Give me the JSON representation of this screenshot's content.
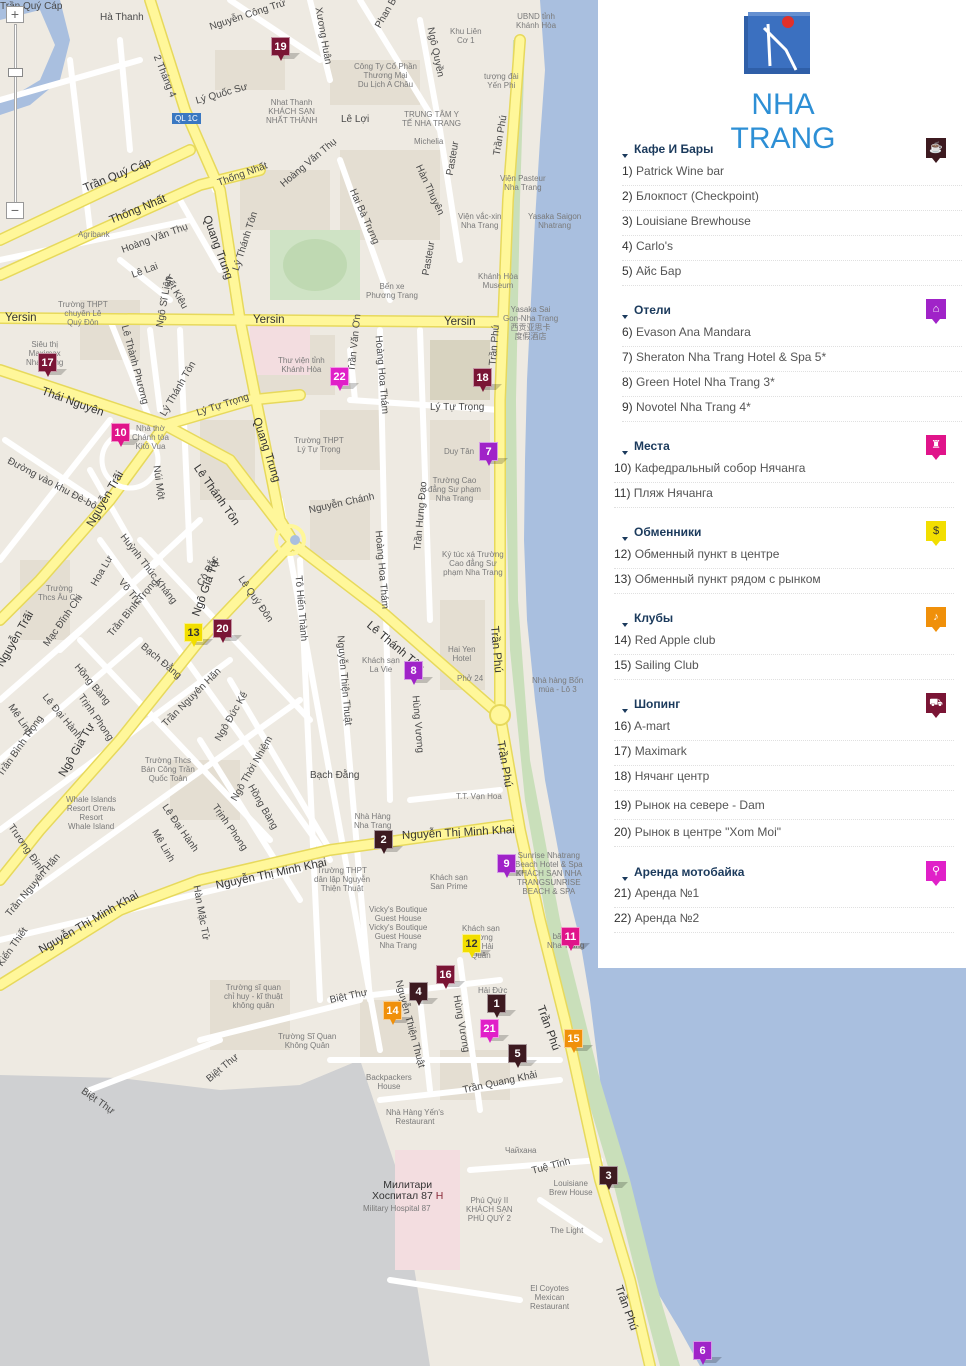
{
  "zoom": {
    "plus_label": "+",
    "minus_label": "−"
  },
  "colors": {
    "water": "#a9bfdf",
    "road_major": "#fff79a",
    "road_minor": "#ffffff",
    "land": "#eeeae2",
    "block": "#e4ded2",
    "park": "#cfe3c5",
    "highlight": "#f3dde0",
    "cafe": "#3d1a20",
    "hotel": "#a023c8",
    "place": "#e0148a",
    "exchange": "#f2de00",
    "club": "#f0900a",
    "shop": "#7a1535",
    "moto": "#e020c8"
  },
  "streets": [
    {
      "text": "Hà Thanh",
      "key": "s1"
    },
    {
      "text": "Nguyễn Công Trứ",
      "key": "s2"
    },
    {
      "text": "Xương Huân",
      "key": "s3"
    },
    {
      "text": "Phan Bội Châu",
      "key": "s4"
    },
    {
      "text": "Ngô Quyền",
      "key": "s5"
    },
    {
      "text": "2 Tháng 4",
      "key": "s6"
    },
    {
      "text": "Lý Quốc Sư",
      "key": "s7"
    },
    {
      "text": "Lê Lợi",
      "key": "s8"
    },
    {
      "text": "Trần Quý Cáp",
      "key": "s9"
    },
    {
      "text": "Thống Nhất",
      "key": "s10"
    },
    {
      "text": "Thống Nhất",
      "key": "s11"
    },
    {
      "text": "Hoàng Văn Thụ",
      "key": "s12"
    },
    {
      "text": "Hoàng Văn Thụ",
      "key": "s13"
    },
    {
      "text": "Quang Trung",
      "key": "s14"
    },
    {
      "text": "Lý Thánh Tôn",
      "key": "s15"
    },
    {
      "text": "Hai Bà Trưng",
      "key": "s16"
    },
    {
      "text": "Pasteur",
      "key": "s17"
    },
    {
      "text": "Hàn Thuyên",
      "key": "s18"
    },
    {
      "text": "Pasteur",
      "key": "s19"
    },
    {
      "text": "Trần Phú",
      "key": "s20"
    },
    {
      "text": "Yersin",
      "key": "s21"
    },
    {
      "text": "Yersin",
      "key": "s22"
    },
    {
      "text": "Yersin",
      "key": "s23"
    },
    {
      "text": "Lê Lai",
      "key": "s24"
    },
    {
      "text": "Yết Kiêu",
      "key": "s25"
    },
    {
      "text": "Lê Thành Phương",
      "key": "s26"
    },
    {
      "text": "Ngô Sĩ Liên",
      "key": "s27"
    },
    {
      "text": "Lý Thánh Tôn",
      "key": "s28"
    },
    {
      "text": "Thái Nguyên",
      "key": "s29"
    },
    {
      "text": "Lý Tự Trọng",
      "key": "s30"
    },
    {
      "text": "Lý Tự Trọng",
      "key": "s31"
    },
    {
      "text": "Quang Trung",
      "key": "s32"
    },
    {
      "text": "Trần Văn Ơn",
      "key": "s33"
    },
    {
      "text": "Hoàng Hoa Thám",
      "key": "s34"
    },
    {
      "text": "Trần Phú",
      "key": "s35"
    },
    {
      "text": "Lê Thánh Tôn",
      "key": "s36"
    },
    {
      "text": "Nguyễn Trãi",
      "key": "s37"
    },
    {
      "text": "Nguyễn Chánh",
      "key": "s38"
    },
    {
      "text": "Hoàng Hoa Thám",
      "key": "s39"
    },
    {
      "text": "Trần Hưng Đạo",
      "key": "s40"
    },
    {
      "text": "Lê Thánh Tôn",
      "key": "s41"
    },
    {
      "text": "Trần Phú",
      "key": "s42"
    },
    {
      "text": "Huỳnh Thúc Kháng",
      "key": "s43"
    },
    {
      "text": "Võ Trứ",
      "key": "s44"
    },
    {
      "text": "Hoa Lư",
      "key": "s45"
    },
    {
      "text": "Cô Bắc",
      "key": "s46"
    },
    {
      "text": "Lê Quý Đôn",
      "key": "s47"
    },
    {
      "text": "Tô Hiến Thành",
      "key": "s48"
    },
    {
      "text": "Nguyễn Thiện Thuật",
      "key": "s49"
    },
    {
      "text": "Hùng Vương",
      "key": "s50"
    },
    {
      "text": "Ngô Gia Tự",
      "key": "s51"
    },
    {
      "text": "Trần Bình Trọng",
      "key": "s52"
    },
    {
      "text": "Bạch Đằng",
      "key": "s53"
    },
    {
      "text": "Trần Nguyên Hãn",
      "key": "s54"
    },
    {
      "text": "Ngô Đức Kế",
      "key": "s55"
    },
    {
      "text": "Ngô Thời Nhiệm",
      "key": "s56"
    },
    {
      "text": "Hồng Bàng",
      "key": "s57"
    },
    {
      "text": "Trịnh Phong",
      "key": "s58"
    },
    {
      "text": "Lê Đại Hành",
      "key": "s59"
    },
    {
      "text": "Mê Linh",
      "key": "s60"
    },
    {
      "text": "Ngô Gia Tự",
      "key": "s61"
    },
    {
      "text": "Bạch Đằng",
      "key": "s62"
    },
    {
      "text": "Nguyễn Thị Minh Khai",
      "key": "s63"
    },
    {
      "text": "Nguyễn Thị Minh Khai",
      "key": "s64"
    },
    {
      "text": "Nguyễn Thị Minh Khai",
      "key": "s65"
    },
    {
      "text": "Hàn Mặc Tử",
      "key": "s66"
    },
    {
      "text": "Trần Phú",
      "key": "s67"
    },
    {
      "text": "Biệt Thự",
      "key": "s68"
    },
    {
      "text": "Nguyễn Thiện Thuật",
      "key": "s69"
    },
    {
      "text": "Hùng Vương",
      "key": "s70"
    },
    {
      "text": "Trần Quang Khải",
      "key": "s71"
    },
    {
      "text": "Trần Phú",
      "key": "s72"
    },
    {
      "text": "Biệt Thự",
      "key": "s73"
    },
    {
      "text": "Biệt Thự",
      "key": "s74"
    },
    {
      "text": "Tuệ Tĩnh",
      "key": "s75"
    },
    {
      "text": "Trần Phú",
      "key": "s76"
    },
    {
      "text": "Mạc Đĩnh Chi",
      "key": "s77"
    },
    {
      "text": "Hồng Bàng",
      "key": "s78"
    },
    {
      "text": "Trịnh Phong",
      "key": "s79"
    },
    {
      "text": "Mê Linh",
      "key": "s80"
    },
    {
      "text": "Lê Đại Hành",
      "key": "s81"
    },
    {
      "text": "Trần Bình Trọng",
      "key": "s82"
    },
    {
      "text": "Trương Định",
      "key": "s83"
    },
    {
      "text": "Trần Nguyên Hãn",
      "key": "s84"
    },
    {
      "text": "Kiến Thiết",
      "key": "s85"
    },
    {
      "text": "Nguyễn Trãi",
      "key": "s86"
    },
    {
      "text": "Đường vào khu Đè-bô",
      "key": "s87"
    },
    {
      "text": "Núi Một",
      "key": "s88"
    },
    {
      "text": "Trần Quý Cáp",
      "key": "s89"
    }
  ],
  "places": [
    {
      "text": "UBND tỉnh\nKhánh Hòa",
      "key": "p1"
    },
    {
      "text": "Khu Liên\nCơ 1",
      "key": "p2"
    },
    {
      "text": "tượng đài\nYến Phi",
      "key": "p3"
    },
    {
      "text": "Công Ty Cổ Phần\nThương Mại\nDu Lịch A Châu",
      "key": "p4"
    },
    {
      "text": "Nhat Thanh\nKHÁCH SẠN\nNHẤT THÀNH",
      "key": "p5"
    },
    {
      "text": "TRUNG TÂM Y\nTẾ NHA TRANG",
      "key": "p6"
    },
    {
      "text": "Michelia",
      "key": "p7"
    },
    {
      "text": "Viện Pasteur\nNha Trang",
      "key": "p8"
    },
    {
      "text": "Viện vắc-xin\nNha Trang",
      "key": "p9"
    },
    {
      "text": "Yasaka Saigon\nNhatrang",
      "key": "p10"
    },
    {
      "text": "Agribank",
      "key": "p11"
    },
    {
      "text": "Bến xe\nPhương Trang",
      "key": "p12"
    },
    {
      "text": "Khánh Hòa\nMuseum",
      "key": "p13"
    },
    {
      "text": "Yasaka Sai\nGon-Nha Trang\n西贡亚思卡\n度假酒店",
      "key": "p14"
    },
    {
      "text": "Trường THPT\nchuyên Lê\nQuý Đôn",
      "key": "p15"
    },
    {
      "text": "Siêu thị\nMaximax\nNha Trang",
      "key": "p16"
    },
    {
      "text": "Thư viện tỉnh\nKhánh Hòa",
      "key": "p17"
    },
    {
      "text": "Nhà thờ\nChánh tòa\nKitô Vua",
      "key": "p18"
    },
    {
      "text": "Trường THPT\nLý Tự Trọng",
      "key": "p19"
    },
    {
      "text": "Duy Tân",
      "key": "p20"
    },
    {
      "text": "Trường Cao\nđẳng Sư phạm\nNha Trang",
      "key": "p21"
    },
    {
      "text": "Ký túc xá Trường\nCao đẳng Sư\nphạm Nha Trang",
      "key": "p22"
    },
    {
      "text": "Khách sạn\nLa Vie",
      "key": "p23"
    },
    {
      "text": "Hai Yen\nHotel",
      "key": "p24"
    },
    {
      "text": "Phở 24",
      "key": "p25"
    },
    {
      "text": "Nhà hàng Bốn\nmùa - Lô 3",
      "key": "p26"
    },
    {
      "text": "Trường\nThcs Âu Cơ",
      "key": "p27"
    },
    {
      "text": "Trường Thcs\nBán Công Trần\nQuốc Toản",
      "key": "p28"
    },
    {
      "text": "Whale Islands\nResort Отель\nResort\nWhale Island",
      "key": "p29"
    },
    {
      "text": "T.T. Vạn Hoa",
      "key": "p30"
    },
    {
      "text": "Nhà Hàng\nNha Trang",
      "key": "p31"
    },
    {
      "text": "Sunrise Nhatrang\nBeach Hotel & Spa\nKHÁCH SẠN NHA\nTRANGSUNRISE\nBEACH & SPA",
      "key": "p32"
    },
    {
      "text": "Trường THPT\ndân lập Nguyễn\nThiện Thuật",
      "key": "p33"
    },
    {
      "text": "Khách sạn\nSan Prime",
      "key": "p34"
    },
    {
      "text": "Vicky's Boutique\nGuest House\nVicky's Boutique\nGuest House\nNha Trang",
      "key": "p35"
    },
    {
      "text": "Khách sạn\nLương\nNK Hải\nQuân",
      "key": "p36"
    },
    {
      "text": "bãi tắm\nNha Trang",
      "key": "p37"
    },
    {
      "text": "Trường sĩ quan\nchỉ huy - kĩ thuật\nkhông quân",
      "key": "p38"
    },
    {
      "text": "Trường Sĩ Quan\nKhông Quân",
      "key": "p39"
    },
    {
      "text": "Backpackers\nHouse",
      "key": "p40"
    },
    {
      "text": "Nhà Hàng Yến's\nRestaurant",
      "key": "p41"
    },
    {
      "text": "Louisiane\nBrew House",
      "key": "p42"
    },
    {
      "text": "Phú Quý II\nKHÁCH SẠN\nPHÚ QUÝ 2",
      "key": "p43"
    },
    {
      "text": "The Light",
      "key": "p44"
    },
    {
      "text": "El Coyotes\nMexican\nRestaurant",
      "key": "p45"
    },
    {
      "text": "Military Hospital 87",
      "key": "p46"
    },
    {
      "text": "Чайханa",
      "key": "p47"
    },
    {
      "text": "Hải Đức",
      "key": "p48"
    }
  ],
  "hospital_title": "Милитари\nХоспитал 87",
  "route_badge": "QL 1C",
  "markers": [
    {
      "n": "1",
      "cat": "cafe"
    },
    {
      "n": "2",
      "cat": "cafe"
    },
    {
      "n": "3",
      "cat": "cafe"
    },
    {
      "n": "4",
      "cat": "cafe"
    },
    {
      "n": "5",
      "cat": "cafe"
    },
    {
      "n": "6",
      "cat": "hotel"
    },
    {
      "n": "7",
      "cat": "hotel"
    },
    {
      "n": "8",
      "cat": "hotel"
    },
    {
      "n": "9",
      "cat": "hotel"
    },
    {
      "n": "10",
      "cat": "place"
    },
    {
      "n": "11",
      "cat": "place"
    },
    {
      "n": "12",
      "cat": "exchange"
    },
    {
      "n": "13",
      "cat": "exchange"
    },
    {
      "n": "14",
      "cat": "club"
    },
    {
      "n": "15",
      "cat": "club"
    },
    {
      "n": "16",
      "cat": "shop"
    },
    {
      "n": "17",
      "cat": "shop"
    },
    {
      "n": "18",
      "cat": "shop"
    },
    {
      "n": "19",
      "cat": "shop"
    },
    {
      "n": "20",
      "cat": "shop"
    },
    {
      "n": "21",
      "cat": "moto"
    },
    {
      "n": "22",
      "cat": "moto"
    }
  ],
  "panel": {
    "logo_text": "NHA TRANG",
    "categories": [
      {
        "title": "Кафе И Бары",
        "icon": "cafe-icon",
        "items": [
          {
            "num": "1)",
            "label": "Patrick Wine bar"
          },
          {
            "num": "2)",
            "label": "Блокпост (Checkpoint)"
          },
          {
            "num": "3)",
            "label": "Louisiane Brewhouse"
          },
          {
            "num": "4)",
            "label": "Carlo's"
          },
          {
            "num": "5)",
            "label": "Айс Бар"
          }
        ]
      },
      {
        "title": "Отели",
        "icon": "hotel-icon",
        "items": [
          {
            "num": "6)",
            "label": "Evason Ana Mandara"
          },
          {
            "num": "7)",
            "label": "Sheraton Nha Trang Hotel & Spa 5*"
          },
          {
            "num": "8)",
            "label": "Green Hotel Nha Trang 3*"
          },
          {
            "num": "9)",
            "label": "Novotel Nha Trang 4*"
          }
        ]
      },
      {
        "title": "Места",
        "icon": "landmark-icon",
        "items": [
          {
            "num": "10)",
            "label": "Кафедральный собор Нячанга"
          },
          {
            "num": "11)",
            "label": "Пляж Нячанга"
          }
        ]
      },
      {
        "title": "Обменники",
        "icon": "money-bag-icon",
        "items": [
          {
            "num": "12)",
            "label": "Обменный пункт в центре"
          },
          {
            "num": "13)",
            "label": "Обменный пункт рядом с рынком"
          }
        ]
      },
      {
        "title": "Клубы",
        "icon": "dancers-icon",
        "items": [
          {
            "num": "14)",
            "label": "Red Apple club"
          },
          {
            "num": "15)",
            "label": "Sailing Club"
          }
        ]
      },
      {
        "title": "Шопинг",
        "icon": "shopping-cart-icon",
        "items": [
          {
            "num": "16)",
            "label": "A-mart"
          },
          {
            "num": "17)",
            "label": "Maximark"
          },
          {
            "num": "18)",
            "label": "Нячанг центр"
          },
          {
            "num": "19)",
            "label": "Рынок на севере - Dam"
          },
          {
            "num": "20)",
            "label": "Рынок в центре \"Xom Moi\""
          }
        ]
      },
      {
        "title": "Аренда мотобайка",
        "icon": "motorbike-icon",
        "items": [
          {
            "num": "21)",
            "label": "Аренда №1"
          },
          {
            "num": "22)",
            "label": "Аренда №2"
          }
        ]
      }
    ]
  }
}
